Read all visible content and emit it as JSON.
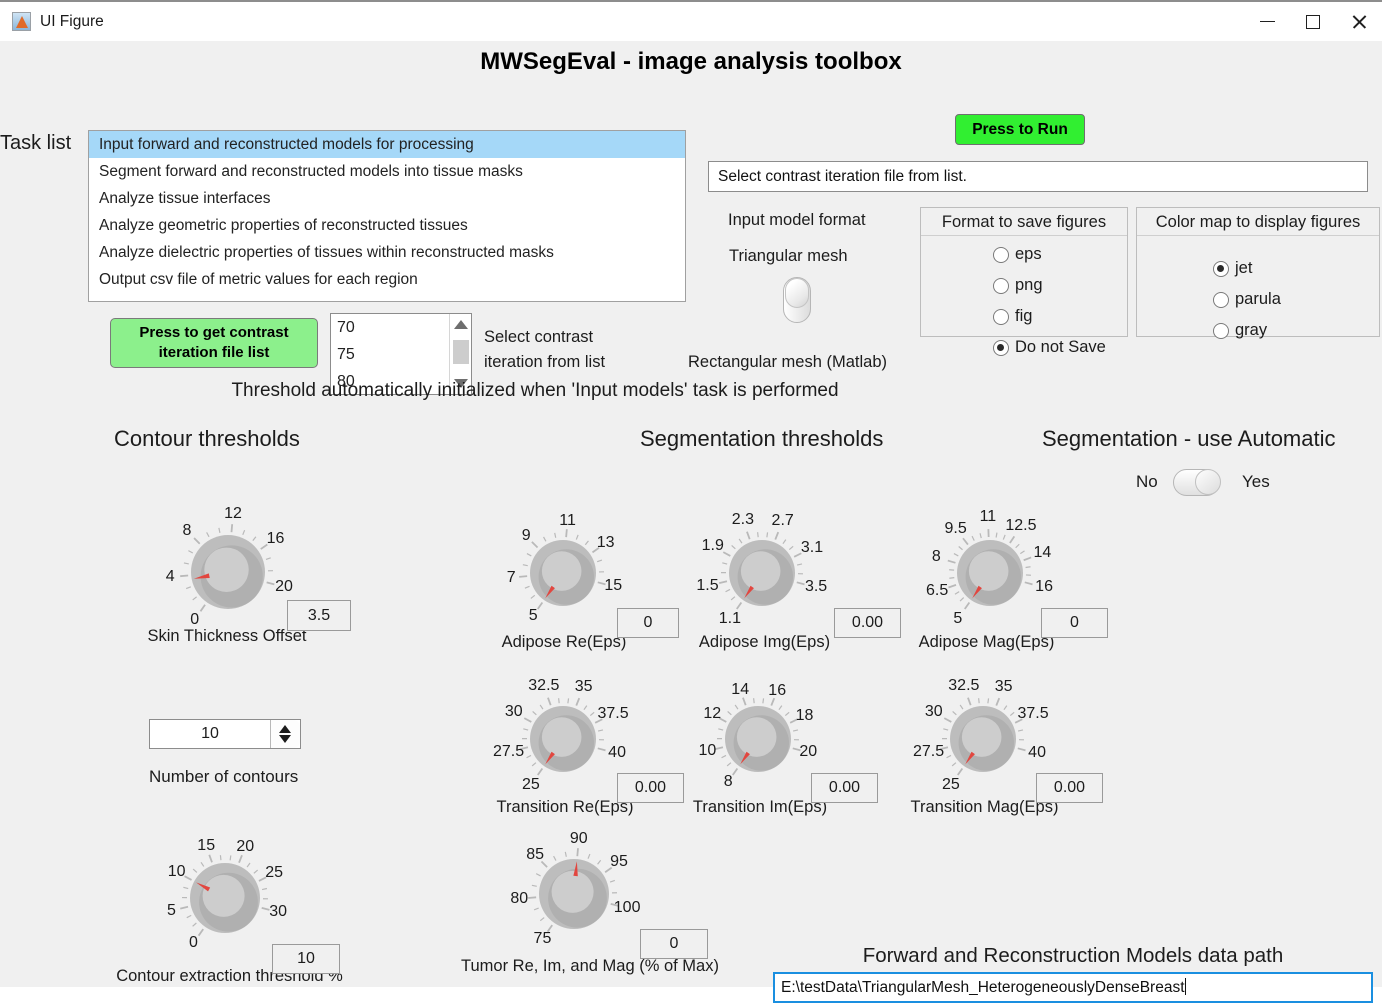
{
  "window": {
    "title": "UI Figure",
    "icon": "matlab-icon",
    "minimize": "minimize-icon",
    "maximize": "maximize-icon",
    "close": "close-icon"
  },
  "header": {
    "title": "MWSegEval - image analysis toolbox"
  },
  "task_list": {
    "label": "Task list",
    "items": [
      {
        "label": "Input forward and reconstructed models for processing",
        "selected": true
      },
      {
        "label": "Segment forward and reconstructed models into tissue masks",
        "selected": false
      },
      {
        "label": "Analyze tissue interfaces",
        "selected": false
      },
      {
        "label": "Analyze geometric properties of reconstructed tissues",
        "selected": false
      },
      {
        "label": "Analyze dielectric properties of tissues within reconstructed masks",
        "selected": false
      },
      {
        "label": "Output csv file of metric values for each region",
        "selected": false
      }
    ]
  },
  "run": {
    "label": "Press to Run",
    "color": "#31ef31"
  },
  "status": {
    "message": "Select contrast iteration file from list."
  },
  "input_model_format": {
    "label": "Input model format",
    "top_option": "Triangular mesh",
    "bottom_option": "Rectangular mesh (Matlab)",
    "selected": "Triangular mesh"
  },
  "format_panel": {
    "title": "Format to save figures",
    "options": [
      {
        "label": "eps",
        "selected": false
      },
      {
        "label": "png",
        "selected": false
      },
      {
        "label": "fig",
        "selected": false
      },
      {
        "label": "Do not Save",
        "selected": true
      }
    ]
  },
  "colormap_panel": {
    "title": "Color map to display figures",
    "options": [
      {
        "label": "jet",
        "selected": true
      },
      {
        "label": "parula",
        "selected": false
      },
      {
        "label": "gray",
        "selected": false
      }
    ]
  },
  "contrast": {
    "button_label": "Press to get contrast\niteration file list",
    "button_line1": "Press to get contrast",
    "button_line2": "iteration file list",
    "list_items": [
      "70",
      "75",
      "80"
    ],
    "hint_line1": "Select contrast",
    "hint_line2": "iteration from list",
    "button_color": "#8cf08c"
  },
  "threshold_note": "Threshold automatically initialized when 'Input models' task is performed",
  "sections": {
    "contour": "Contour thresholds",
    "segmentation": "Segmentation thresholds",
    "auto": "Segmentation - use Automatic"
  },
  "auto_segmentation": {
    "off_label": "No",
    "on_label": "Yes",
    "value": "No"
  },
  "number_of_contours": {
    "value": "10",
    "caption": "Number of contours"
  },
  "knobs": [
    {
      "id": "skin-thickness-offset",
      "caption": "Skin Thickness Offset",
      "value": "3.5",
      "ticks": [
        "0",
        "4",
        "8",
        "12",
        "16",
        "20"
      ],
      "min": 0,
      "max": 20,
      "pointer": 3.5
    },
    {
      "id": "adipose-re-eps",
      "caption": "Adipose Re(Eps)",
      "value": "0",
      "ticks": [
        "5",
        "7",
        "9",
        "11",
        "13",
        "15"
      ],
      "min": 5,
      "max": 15,
      "pointer": 5
    },
    {
      "id": "adipose-img-eps",
      "caption": "Adipose Img(Eps)",
      "value": "0.00",
      "ticks": [
        "1.1",
        "1.5",
        "1.9",
        "2.3",
        "2.7",
        "3.1",
        "3.5"
      ],
      "min": 1.1,
      "max": 3.5,
      "pointer": 1.1
    },
    {
      "id": "adipose-mag-eps",
      "caption": "Adipose Mag(Eps)",
      "value": "0",
      "ticks": [
        "5",
        "6.5",
        "8",
        "9.5",
        "11",
        "12.5",
        "14",
        "16"
      ],
      "min": 5,
      "max": 16,
      "pointer": 5
    },
    {
      "id": "transition-re-eps",
      "caption": "Transition Re(Eps)",
      "value": "0.00",
      "ticks": [
        "25",
        "27.5",
        "30",
        "32.5",
        "35",
        "37.5",
        "40"
      ],
      "min": 25,
      "max": 40,
      "pointer": 25
    },
    {
      "id": "transition-im-eps",
      "caption": "Transition Im(Eps)",
      "value": "0.00",
      "ticks": [
        "8",
        "10",
        "12",
        "14",
        "16",
        "18",
        "20"
      ],
      "min": 8,
      "max": 20,
      "pointer": 8
    },
    {
      "id": "transition-mag-eps",
      "caption": "Transition Mag(Eps)",
      "value": "0.00",
      "ticks": [
        "25",
        "27.5",
        "30",
        "32.5",
        "35",
        "37.5",
        "40"
      ],
      "min": 25,
      "max": 40,
      "pointer": 25
    },
    {
      "id": "contour-extraction-threshold",
      "caption": "Contour extraction threshold %",
      "value": "10",
      "ticks": [
        "0",
        "5",
        "10",
        "15",
        "20",
        "25",
        "30"
      ],
      "min": 0,
      "max": 30,
      "pointer": 10
    },
    {
      "id": "tumor-re-im-mag",
      "caption": "Tumor Re, Im, and Mag (% of Max)",
      "value": "0",
      "ticks": [
        "75",
        "80",
        "85",
        "90",
        "95",
        "100"
      ],
      "min": 75,
      "max": 100,
      "pointer": 90
    }
  ],
  "data_path": {
    "label": "Forward and Reconstruction Models data path",
    "value": "E:\\testData\\TriangularMesh_HeterogeneouslyDenseBreast"
  }
}
